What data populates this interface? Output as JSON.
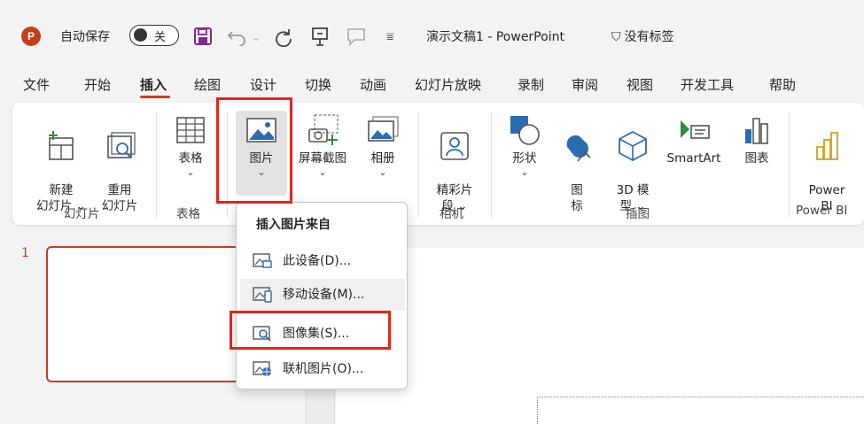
{
  "titlebar": {
    "app_logo": "P",
    "autosave_label": "自动保存",
    "autosave_state": "关",
    "save_icon": "floppy-icon",
    "doc_title": "演示文稿1  -  PowerPoint",
    "sensitivity_label": "没有标签",
    "colors": {
      "accent": "#c43e1c",
      "save": "#7b2b8c"
    }
  },
  "menu": {
    "items": [
      "文件",
      "开始",
      "插入",
      "绘图",
      "设计",
      "切换",
      "动画",
      "幻灯片放映",
      "录制",
      "审阅",
      "视图",
      "开发工具",
      "帮助"
    ],
    "active": "插入"
  },
  "ribbon": {
    "new_slide": "新建\n幻灯片 ⌄",
    "reuse_slide": "重用\n幻灯片",
    "group_slides": "幻灯片",
    "table": "表格",
    "group_table": "表格",
    "pictures": "图片",
    "screenshot": "屏幕截图",
    "album": "相册",
    "cameo": "精彩片\n段 ⌄",
    "group_camera": "相机",
    "shapes": "形状",
    "icons": "图\n标",
    "model3d": "3D 模\n型 ⌄",
    "smartart": "SmartArt",
    "chart": "图表",
    "group_illustrations": "插图",
    "powerbi": "Power\nBI",
    "group_powerbi": "Power BI",
    "caret": "⌄"
  },
  "dropdown": {
    "header": "插入图片来自",
    "items": [
      {
        "label": "此设备(D)...",
        "icon": "device-picture-icon"
      },
      {
        "label": "移动设备(M)...",
        "icon": "mobile-picture-icon"
      },
      {
        "label": "图像集(S)...",
        "icon": "stock-images-icon"
      },
      {
        "label": "联机图片(O)...",
        "icon": "online-picture-icon"
      }
    ],
    "hovered_index": 1,
    "highlighted_index": 2
  },
  "slides": {
    "current_number": "1"
  },
  "highlight_color": "#e5231b"
}
